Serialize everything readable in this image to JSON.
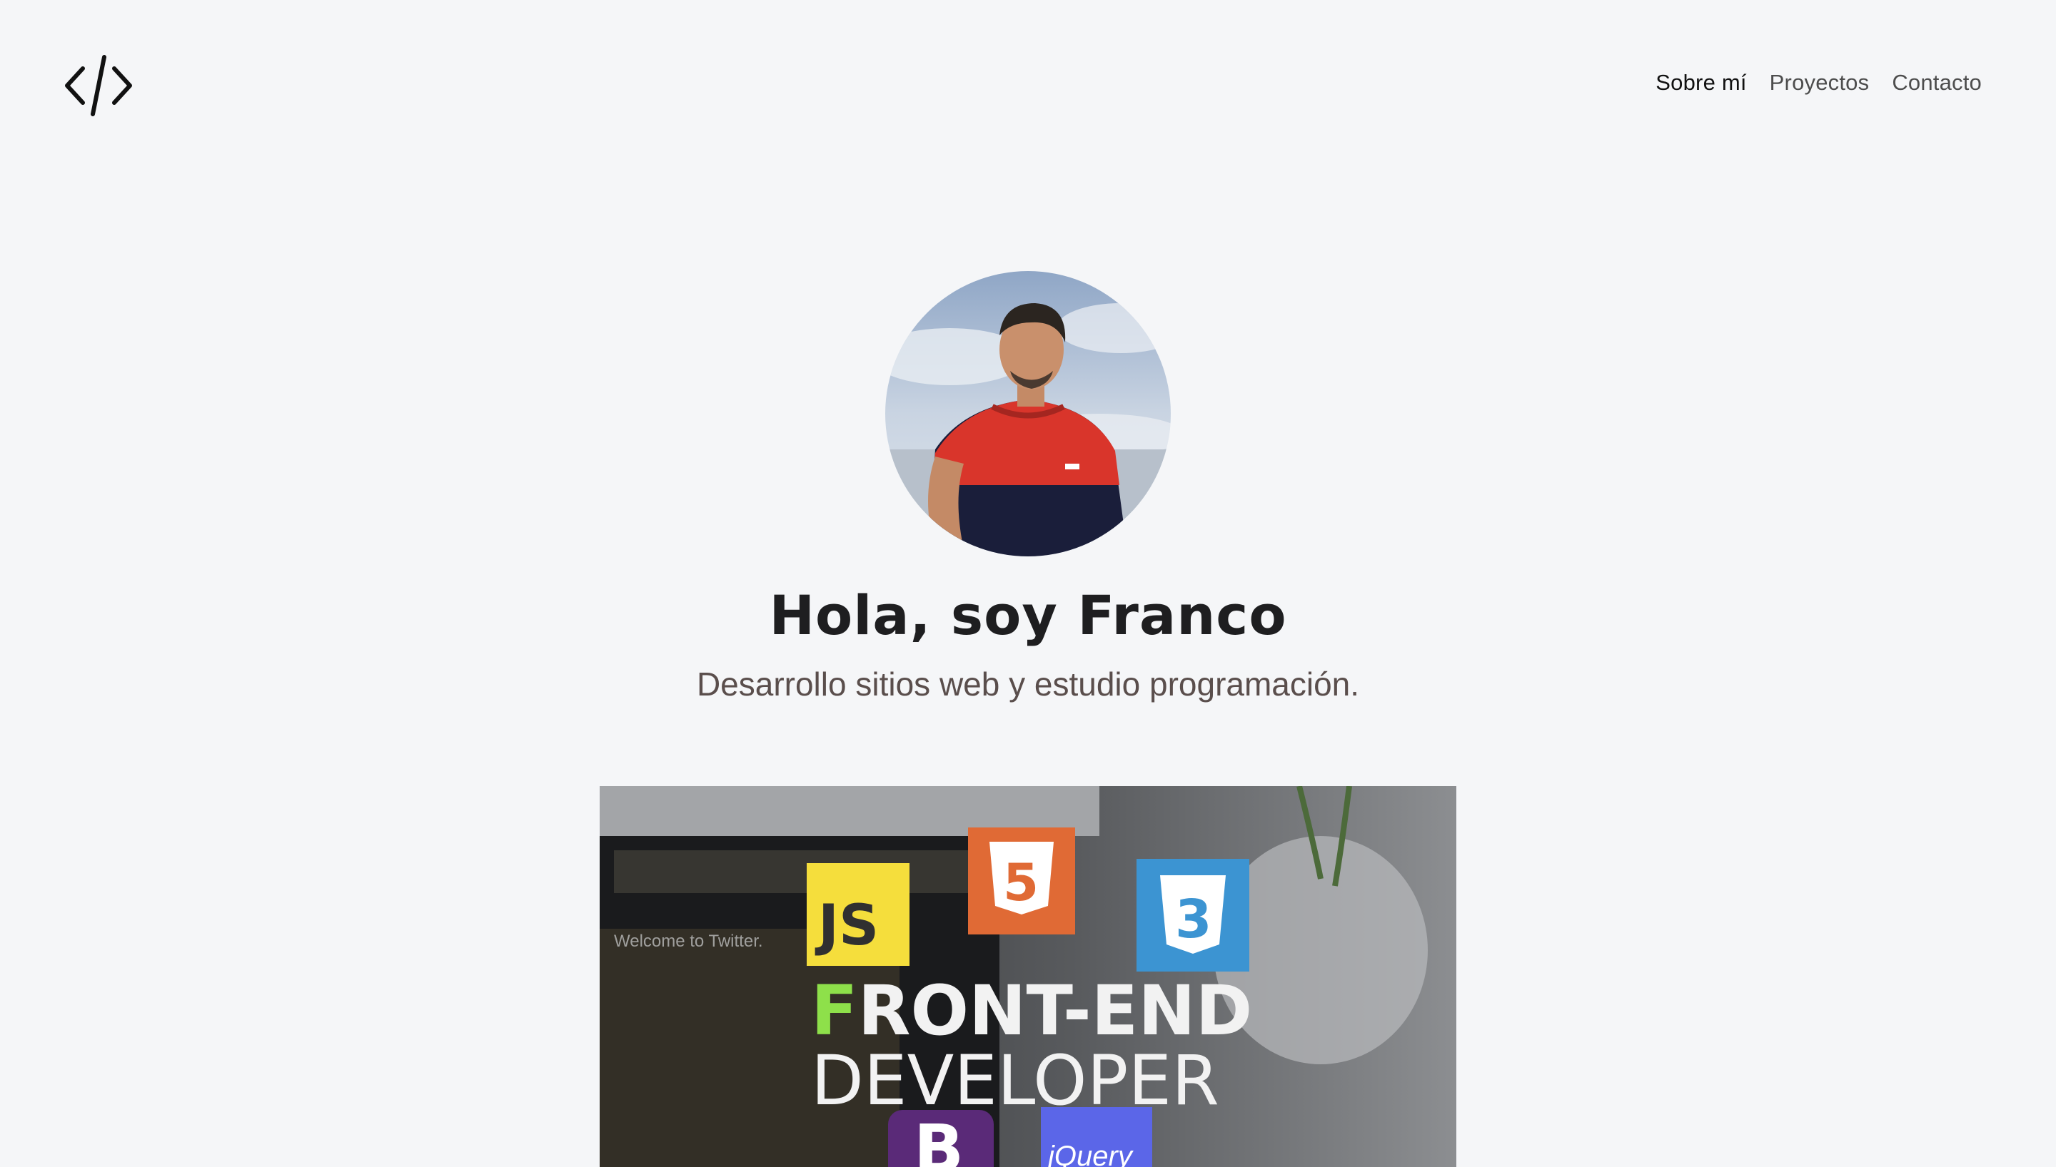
{
  "header": {
    "logo_icon": "code-brackets-icon",
    "nav": [
      {
        "label": "Sobre mí",
        "active": true
      },
      {
        "label": "Proyectos",
        "active": false
      },
      {
        "label": "Contacto",
        "active": false
      }
    ]
  },
  "hero": {
    "avatar_icon": "profile-photo",
    "title": "Hola, soy Franco",
    "subtitle": "Desarrollo sitios web y estudio programación."
  },
  "banner": {
    "badges": {
      "js": "JS",
      "html": "5",
      "css": "3",
      "bootstrap": "B",
      "jquery": "jQuery"
    },
    "headline_1": "FRONT-END",
    "headline_2": "DEVELOPER",
    "screen_text": "Welcome to Twitter.",
    "colors": {
      "js": "#f5de3c",
      "html": "#e06a35",
      "css": "#3c94d2",
      "bootstrap": "#5a2a78",
      "jquery": "#5b66e8",
      "accent_f": "#8ee04a"
    }
  }
}
